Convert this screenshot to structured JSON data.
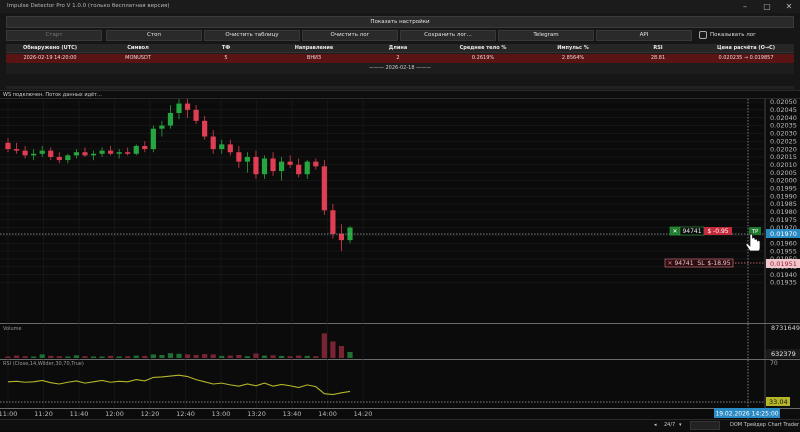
{
  "window": {
    "title": "Impulse Detector Pro V 1.0.0 (только бесплатная версия)"
  },
  "panel": {
    "settings_label": "Показать настройки",
    "buttons": [
      "Старт",
      "Стоп",
      "Очистить таблицу",
      "Очистить лог",
      "Сохранить лог...",
      "Telegram",
      "API"
    ],
    "show_log_label": "Показывать лог"
  },
  "table": {
    "headers": [
      "Обнаружено (UTC)",
      "Символ",
      "ТФ",
      "Направление",
      "Длина",
      "Среднее тело %",
      "Импульс %",
      "RSI",
      "Цена расчёта (O→C)"
    ],
    "rows": [
      [
        "2026-02-19 14:20:00",
        "MONUSDT",
        "5",
        "ВНИЗ",
        "2",
        "0.2619%",
        "2.8564%",
        "28.81",
        "0.020235 → 0.019857"
      ]
    ],
    "date_separator": "——— 2026-02-18 ———"
  },
  "status_text": "WS подключен. Поток данных идёт...",
  "chart": {
    "price_ticks": [
      "0.02050",
      "0.02045",
      "0.02040",
      "0.02035",
      "0.02030",
      "0.02025",
      "0.02020",
      "0.02015",
      "0.02010",
      "0.02005",
      "0.02000",
      "0.01995",
      "0.01990",
      "0.01985",
      "0.01980",
      "0.01975",
      "0.01970",
      "0.01965",
      "0.01960",
      "0.01955",
      "0.01950",
      "0.01945",
      "0.01940",
      "0.01935"
    ],
    "time_ticks": [
      "11:00",
      "11:20",
      "11:40",
      "12:00",
      "12:20",
      "12:40",
      "13:00",
      "13:20",
      "13:40",
      "14:00",
      "14:20"
    ],
    "current_price": "0.01970",
    "sl_price": "0.01951",
    "position": {
      "qty": "94741",
      "pnl": "$ -0.95",
      "tp_label": "TP"
    },
    "stop": {
      "qty": "94741",
      "label": "SL",
      "pnl": "$-18.95"
    },
    "volume_label": "Volume",
    "volume_max": "8731649",
    "volume_current": "632379",
    "rsi_label": "RSI (Close,14,Wilder,30,70,True)",
    "rsi_level": "70",
    "rsi_current": "33.04",
    "crosshair_time": "19.02.2026 14:25:00",
    "colors": {
      "up": "#26a641",
      "down": "#e03e52",
      "rsi": "#b5b52a",
      "bg": "#0b0b0b"
    }
  },
  "bottom": {
    "period": "24/7",
    "dom_label": "DOM Трейдер",
    "chart_trader_label": "Chart Trader"
  }
}
